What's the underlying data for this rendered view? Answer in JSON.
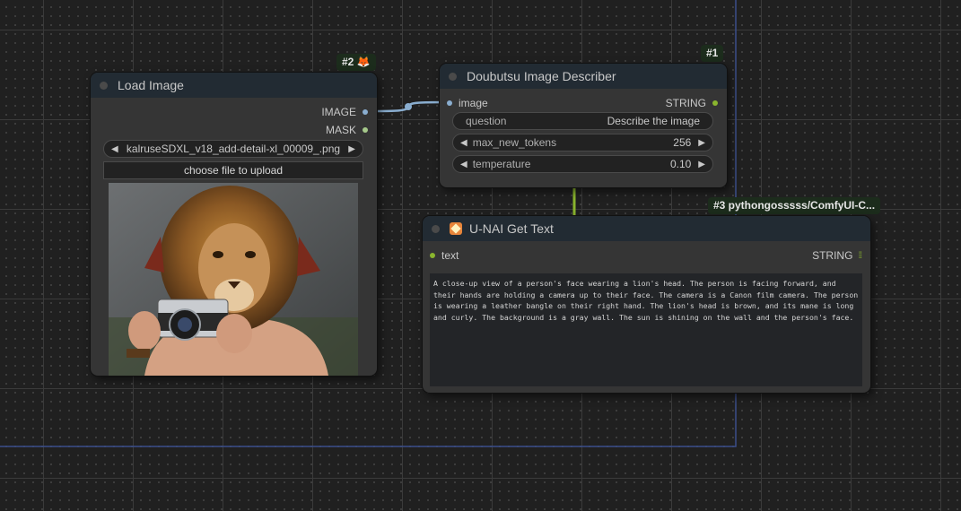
{
  "nodes": {
    "load_image": {
      "title": "Load Image",
      "badge": "#2 🦊",
      "outputs": [
        "IMAGE",
        "MASK"
      ],
      "filename": "kalruseSDXL_v18_add-detail-xl_00009_.png",
      "upload_label": "choose file to upload"
    },
    "describer": {
      "title": "Doubutsu Image Describer",
      "badge": "#1",
      "input": "image",
      "output": "STRING",
      "question": {
        "label": "question",
        "value": "Describe the image"
      },
      "max_new_tokens": {
        "label": "max_new_tokens",
        "value": "256"
      },
      "temperature": {
        "label": "temperature",
        "value": "0.10"
      }
    },
    "get_text": {
      "title": "U-NAI Get Text",
      "badge": "#3 pythongosssss/ComfyUI-C...",
      "input": "text",
      "output": "STRING",
      "text": "A close-up view of a person's face wearing a lion's head. The person is facing forward, and their hands are holding a camera up to their face. The camera is a Canon film camera. The person is wearing a leather bangle on their right hand. The lion's head is brown, and its mane is long and curly. The background is a gray wall. The sun is shining on the wall and the person's face."
    }
  },
  "colors": {
    "image_link": "#8aaed0",
    "string_link": "#8ab52e",
    "mask_slot": "#a6c98b"
  },
  "icons": {
    "widget_left": "triangle-left",
    "widget_right": "triangle-right",
    "get_text_title": "sparkle-icon"
  }
}
